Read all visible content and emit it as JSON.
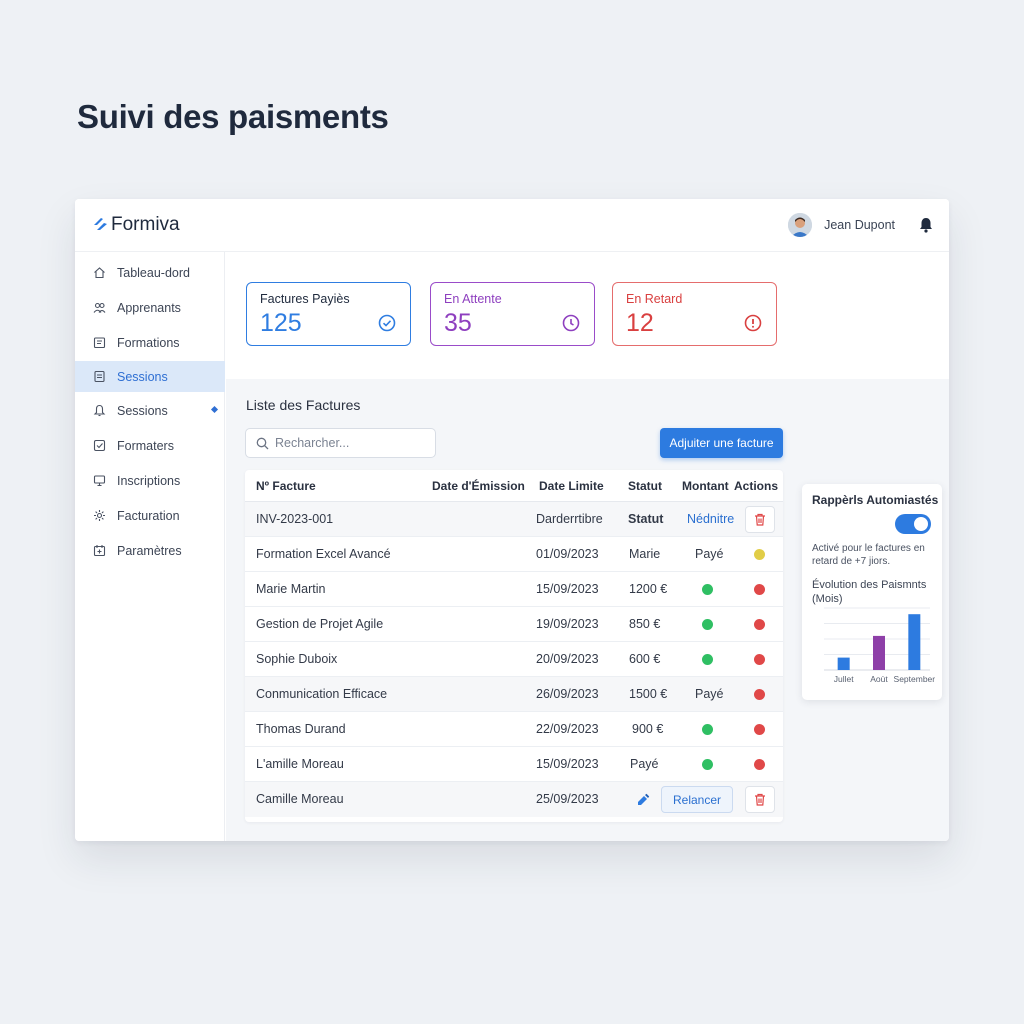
{
  "page": {
    "title": "Suivi des paisments"
  },
  "brand": {
    "name": "Formiva",
    "color": "#2d7be0"
  },
  "user": {
    "name": "Jean Dupont",
    "avatar_icon": "avatar",
    "bell_icon": "bell-icon"
  },
  "sidebar": {
    "items": [
      {
        "label": "Tableau-dord",
        "icon": "home-icon"
      },
      {
        "label": "Apprenants",
        "icon": "users-icon"
      },
      {
        "label": "Formations",
        "icon": "book-icon"
      },
      {
        "label": "Sessions",
        "icon": "document-icon",
        "active": true
      },
      {
        "label": "Sessions",
        "icon": "bell-outline-icon"
      },
      {
        "label": "Formaters",
        "icon": "check-box-icon"
      },
      {
        "label": "Inscriptions",
        "icon": "monitor-icon"
      },
      {
        "label": "Facturation",
        "icon": "settings-icon"
      },
      {
        "label": "Paramètres",
        "icon": "calendar-icon"
      }
    ]
  },
  "cards": [
    {
      "label": "Factures Payiès",
      "value": "125",
      "color": "#2f7de1",
      "icon": "check-circle-icon"
    },
    {
      "label": "En Attente",
      "value": "35",
      "color": "#8e3fbf",
      "icon": "clock-icon"
    },
    {
      "label": "En Retard",
      "value": "12",
      "color": "#df4a4a",
      "icon": "alert-circle-icon"
    }
  ],
  "invoices": {
    "title": "Liste des Factures",
    "search_placeholder": "Recharcher...",
    "add_label": "Adjuiter une facture",
    "columns": [
      "Nº Facture",
      "Date d'Émission",
      "Date Limite",
      "Statut",
      "Montant",
      "Actions"
    ],
    "rows": [
      {
        "name": "INV-2023-001",
        "date": "Darderrtibre",
        "statut": "Statut",
        "montant": "Nédnitre"
      },
      {
        "name": "Formation Excel Avancé",
        "date": "01/09/2023",
        "statut": "Marie",
        "montant": "Payé"
      },
      {
        "name": "Marie Martin",
        "date": "15/09/2023",
        "statut": "1200 €"
      },
      {
        "name": "Gestion de Projet Agile",
        "date": "19/09/2023",
        "statut": "850 €"
      },
      {
        "name": "Sophie Duboix",
        "date": "20/09/2023",
        "statut": "600 €"
      },
      {
        "name": "Conmunication Efficace",
        "date": "26/09/2023",
        "statut": "1500 €",
        "montant": "Payé"
      },
      {
        "name": "Thomas Durand",
        "date": "22/09/2023",
        "statut": "900 €"
      },
      {
        "name": "L'amille Moreau",
        "date": "15/09/2023",
        "statut": "Payé"
      },
      {
        "name": "Camille Moreau",
        "date": "25/09/2023",
        "relancer_label": "Relancer"
      }
    ]
  },
  "reminders": {
    "title": "Rappèrls Automiastés",
    "toggle_on": true,
    "description": "Activé pour le factures en retard de +7 jiors.",
    "chart_title": "Évolution des Paismnts (Mois)"
  },
  "chart_data": {
    "type": "bar",
    "categories": [
      "Jullet",
      "Aoùt",
      "September"
    ],
    "values": [
      4,
      11,
      18
    ],
    "colors": [
      "#2d7be0",
      "#8e3fa8",
      "#2d7be0"
    ],
    "ylim": [
      0,
      20
    ],
    "grid": true
  }
}
